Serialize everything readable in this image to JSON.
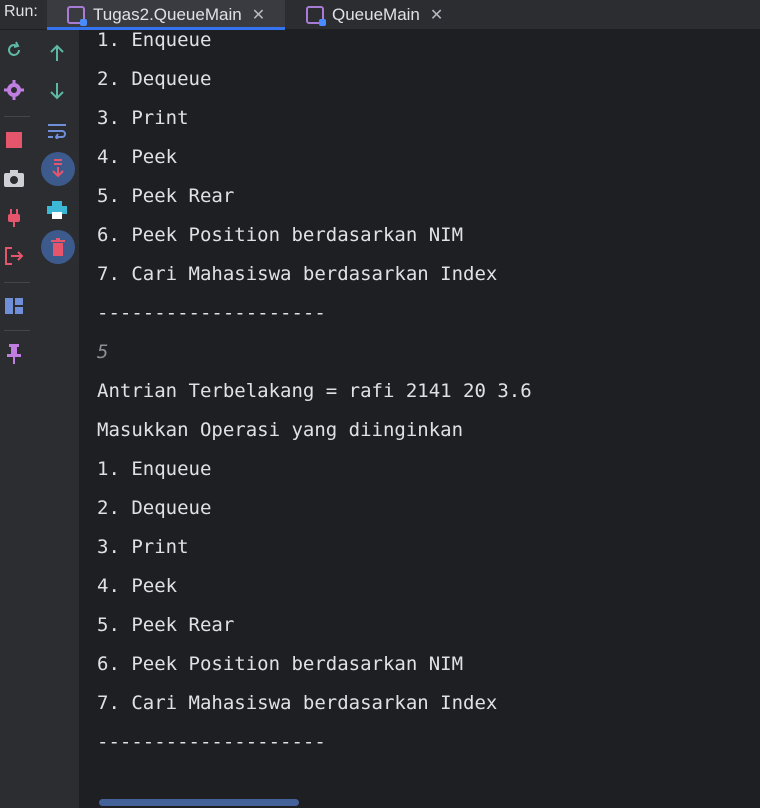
{
  "run": {
    "label": "Run:"
  },
  "tabs": [
    {
      "label": "Tugas2.QueueMain",
      "close": "✕",
      "active": true
    },
    {
      "label": "QueueMain",
      "close": "✕",
      "active": false
    }
  ],
  "icons": {
    "rerun": "rerun-icon",
    "settings": "gear-icon",
    "stop": "stop-icon",
    "snapshot": "camera-icon",
    "attach": "plug-icon",
    "exit": "exit-icon",
    "layout": "layout-icon",
    "pin": "pin-icon",
    "up": "arrow-up-icon",
    "down": "arrow-down-icon",
    "wrap": "soft-wrap-icon",
    "scroll_end": "scroll-to-end-icon",
    "print": "print-icon",
    "clear": "trash-icon"
  },
  "colors": {
    "console_bg": "#1e1f22",
    "panel_bg": "#2b2d30",
    "tab_accent": "#3574f0",
    "text": "#dfe1e5",
    "input_text": "#8c8f94"
  },
  "console": {
    "lines": [
      {
        "text": "1. Enqueue",
        "kind": "output"
      },
      {
        "text": "2. Dequeue",
        "kind": "output"
      },
      {
        "text": "3. Print",
        "kind": "output"
      },
      {
        "text": "4. Peek",
        "kind": "output"
      },
      {
        "text": "5. Peek Rear",
        "kind": "output"
      },
      {
        "text": "6. Peek Position berdasarkan NIM",
        "kind": "output"
      },
      {
        "text": "7. Cari Mahasiswa berdasarkan Index",
        "kind": "output"
      },
      {
        "text": "--------------------",
        "kind": "output"
      },
      {
        "text": "5",
        "kind": "input"
      },
      {
        "text": "Antrian Terbelakang = rafi 2141 20 3.6",
        "kind": "output"
      },
      {
        "text": "Masukkan Operasi yang diinginkan",
        "kind": "output"
      },
      {
        "text": "1. Enqueue",
        "kind": "output"
      },
      {
        "text": "2. Dequeue",
        "kind": "output"
      },
      {
        "text": "3. Print",
        "kind": "output"
      },
      {
        "text": "4. Peek",
        "kind": "output"
      },
      {
        "text": "5. Peek Rear",
        "kind": "output"
      },
      {
        "text": "6. Peek Position berdasarkan NIM",
        "kind": "output"
      },
      {
        "text": "7. Cari Mahasiswa berdasarkan Index",
        "kind": "output"
      },
      {
        "text": "--------------------",
        "kind": "output"
      }
    ]
  }
}
